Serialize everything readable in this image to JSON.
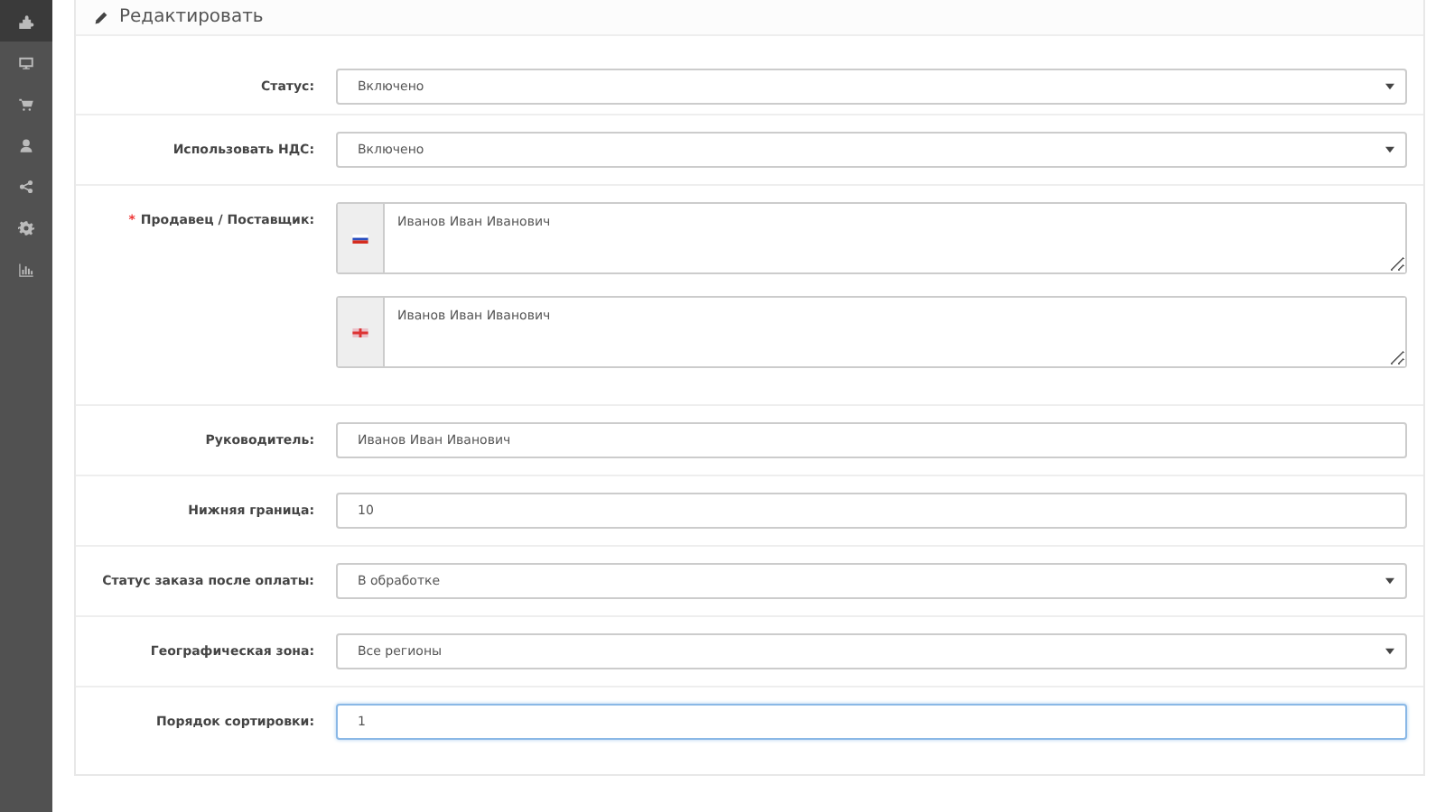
{
  "sidebar": {
    "items": [
      {
        "kind": "puzzle",
        "selected": true
      },
      {
        "kind": "monitor",
        "selected": false
      },
      {
        "kind": "cart",
        "selected": false
      },
      {
        "kind": "user",
        "selected": false
      },
      {
        "kind": "share",
        "selected": false
      },
      {
        "kind": "gear",
        "selected": false
      },
      {
        "kind": "chart",
        "selected": false
      }
    ]
  },
  "panel": {
    "title": "Редактировать",
    "fields": [
      {
        "kind": "select",
        "label": "Статус:",
        "value": "Включено",
        "focused": false
      },
      {
        "kind": "select",
        "label": "Использовать НДС:",
        "value": "Включено",
        "focused": false
      },
      {
        "kind": "multilang",
        "marker": "*",
        "label": "Продавец / Поставщик:",
        "values": [
          {
            "kind": "ru",
            "value": "Иванов Иван Иванович"
          },
          {
            "kind": "gb",
            "value": "Иванов Иван Иванович"
          }
        ]
      },
      {
        "kind": "text",
        "label": "Руководитель:",
        "value": "Иванов Иван Иванович",
        "focused": false
      },
      {
        "kind": "text",
        "label": "Нижняя граница:",
        "value": "10",
        "focused": false
      },
      {
        "kind": "select",
        "label": "Статус заказа после оплаты:",
        "value": "В обработке",
        "focused": false
      },
      {
        "kind": "select",
        "label": "Географическая зона:",
        "value": "Все регионы",
        "focused": false
      },
      {
        "kind": "text",
        "label": "Порядок сортировки:",
        "value": "1",
        "focused": true
      }
    ]
  }
}
